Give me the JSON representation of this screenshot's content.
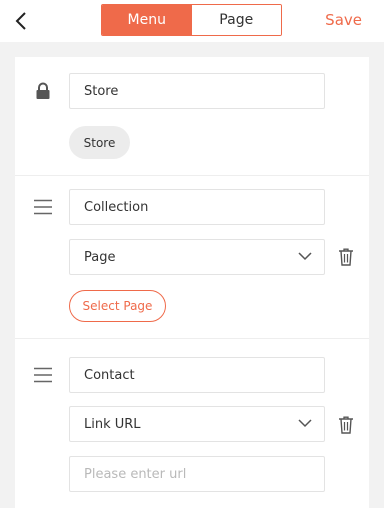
{
  "header": {
    "back_icon": "chevron-left-icon",
    "tabs": [
      {
        "label": "Menu",
        "active": true
      },
      {
        "label": "Page",
        "active": false
      }
    ],
    "save_label": "Save",
    "accent_color": "#ef6a4a"
  },
  "items": [
    {
      "icon": "lock-icon",
      "name_value": "Store",
      "chip_label": "Store"
    },
    {
      "icon": "drag-handle-icon",
      "name_value": "Collection",
      "type_value": "Page",
      "action_label": "Select Page"
    },
    {
      "icon": "drag-handle-icon",
      "name_value": "Contact",
      "type_value": "Link URL",
      "url_placeholder": "Please enter url"
    }
  ]
}
